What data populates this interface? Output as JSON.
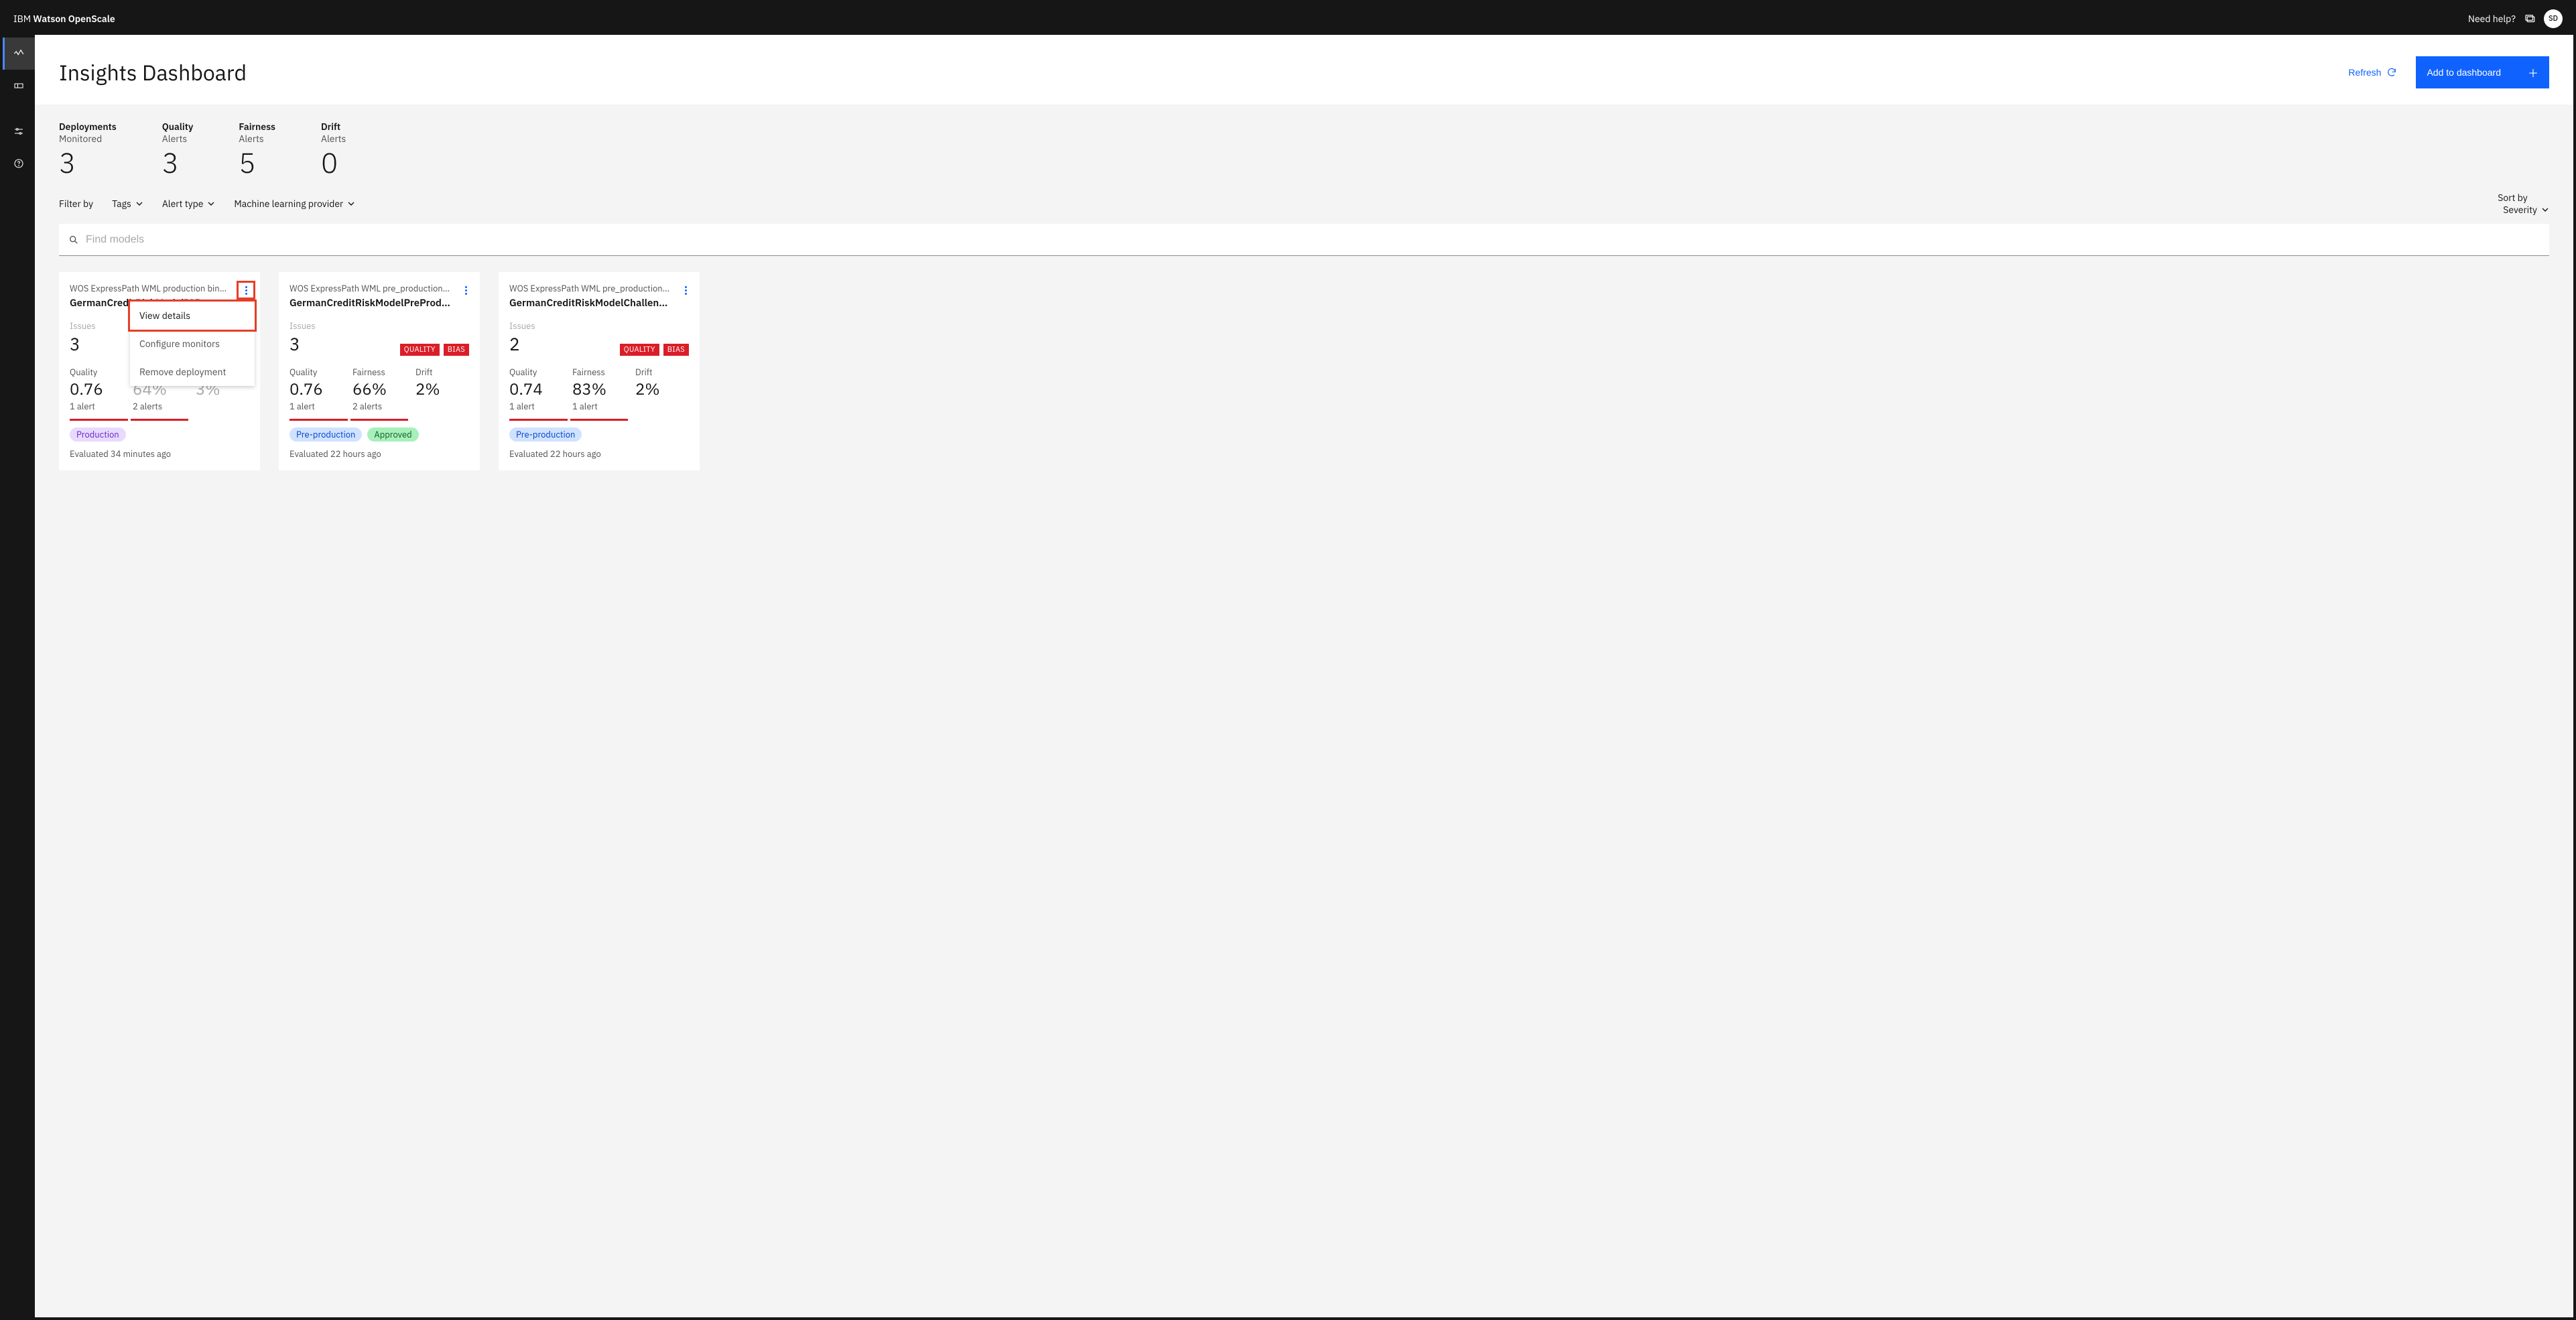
{
  "header": {
    "brand_prefix": "IBM ",
    "brand_bold": "Watson OpenScale",
    "need_help": "Need help?",
    "avatar_initials": "SD"
  },
  "leftnav": {
    "items": [
      {
        "name": "insights-nav",
        "active": true
      },
      {
        "name": "tickets-nav",
        "active": false
      },
      {
        "name": "settings-nav",
        "active": false
      },
      {
        "name": "help-nav",
        "active": false
      }
    ]
  },
  "page": {
    "title": "Insights Dashboard",
    "refresh_label": "Refresh",
    "add_label": "Add to dashboard"
  },
  "summary": [
    {
      "title": "Deployments",
      "sub": "Monitored",
      "value": "3"
    },
    {
      "title": "Quality",
      "sub": "Alerts",
      "value": "3"
    },
    {
      "title": "Fairness",
      "sub": "Alerts",
      "value": "5"
    },
    {
      "title": "Drift",
      "sub": "Alerts",
      "value": "0"
    }
  ],
  "filters": {
    "filter_by_label": "Filter by",
    "dropdowns": [
      {
        "label": "Tags"
      },
      {
        "label": "Alert type"
      },
      {
        "label": "Machine learning provider"
      }
    ],
    "sort_by_label": "Sort by",
    "sort_value": "Severity"
  },
  "search": {
    "placeholder": "Find models"
  },
  "menu": {
    "view_details": "View details",
    "configure": "Configure monitors",
    "remove": "Remove deployment"
  },
  "issues_label": "Issues",
  "metric_labels": {
    "quality": "Quality",
    "fairness": "Fairness",
    "drift": "Drift"
  },
  "cards": [
    {
      "binding": "WOS ExpressPath WML production bindi…",
      "model": "GermanCreditRiskModelICP",
      "issues": "3",
      "alert_tags": [],
      "quality": {
        "value": "0.76",
        "sub": "1 alert"
      },
      "fairness": {
        "value": "64%",
        "sub": "2 alerts"
      },
      "drift": {
        "value": "3%",
        "sub": ""
      },
      "risk_segments": [
        "red",
        "red",
        "none"
      ],
      "env_tags": [
        {
          "cls": "production",
          "text": "Production"
        }
      ],
      "evaluated": "Evaluated 34 minutes ago",
      "menu_open": true
    },
    {
      "binding": "WOS ExpressPath WML pre_production …",
      "model": "GermanCreditRiskModelPreProdI…",
      "issues": "3",
      "alert_tags": [
        "QUALITY",
        "BIAS"
      ],
      "quality": {
        "value": "0.76",
        "sub": "1 alert"
      },
      "fairness": {
        "value": "66%",
        "sub": "2 alerts"
      },
      "drift": {
        "value": "2%",
        "sub": ""
      },
      "risk_segments": [
        "red",
        "red",
        "none"
      ],
      "env_tags": [
        {
          "cls": "preprod",
          "text": "Pre-production"
        },
        {
          "cls": "approved",
          "text": "Approved"
        }
      ],
      "evaluated": "Evaluated 22 hours ago",
      "menu_open": false
    },
    {
      "binding": "WOS ExpressPath WML pre_production …",
      "model": "GermanCreditRiskModelChalleng…",
      "issues": "2",
      "alert_tags": [
        "QUALITY",
        "BIAS"
      ],
      "quality": {
        "value": "0.74",
        "sub": "1 alert"
      },
      "fairness": {
        "value": "83%",
        "sub": "1 alert"
      },
      "drift": {
        "value": "2%",
        "sub": ""
      },
      "risk_segments": [
        "red",
        "red",
        "none"
      ],
      "env_tags": [
        {
          "cls": "preprod",
          "text": "Pre-production"
        }
      ],
      "evaluated": "Evaluated 22 hours ago",
      "menu_open": false
    }
  ]
}
